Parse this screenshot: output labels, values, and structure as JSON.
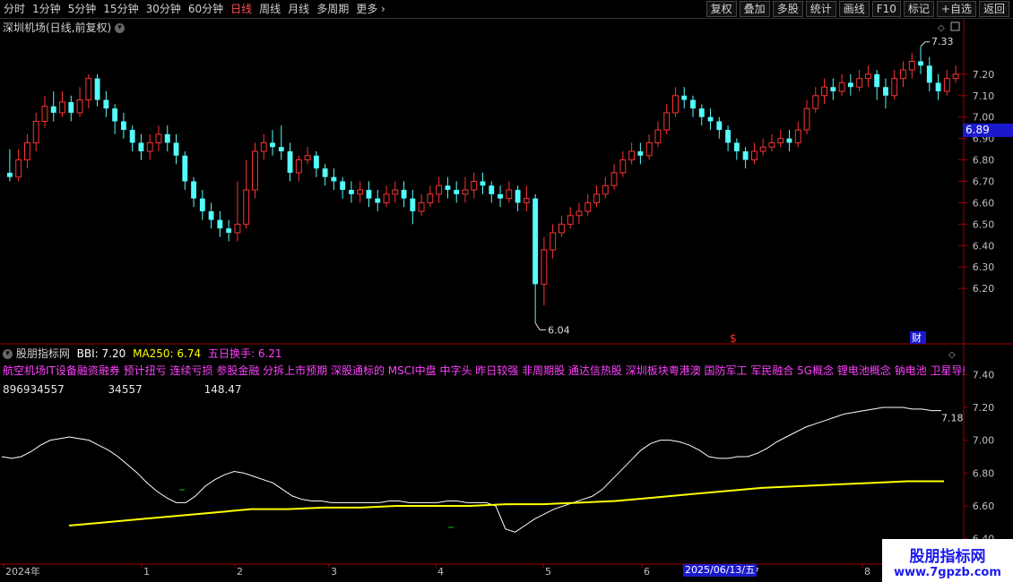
{
  "toolbar": {
    "periods": [
      "分时",
      "1分钟",
      "5分钟",
      "15分钟",
      "30分钟",
      "60分钟",
      "日线",
      "周线",
      "月线",
      "多周期",
      "更多"
    ],
    "active_period": "日线",
    "right_buttons": [
      "复权",
      "叠加",
      "多股",
      "统计",
      "画线",
      "F10",
      "标记",
      "+自选",
      "返回"
    ]
  },
  "main_chart": {
    "title": "深圳机场(日线,前复权)",
    "current_price_tag": "6.89",
    "high_label": "7.33",
    "low_label": "6.04",
    "event_markers": [
      "$",
      "财"
    ],
    "y_ticks": [
      "7.20",
      "7.10",
      "7.00",
      "6.90",
      "6.80",
      "6.70",
      "6.60",
      "6.50",
      "6.40",
      "6.30",
      "6.20"
    ]
  },
  "indicator": {
    "name": "股朋指标网",
    "bbi_label": "BBI: 7.20",
    "ma_label": "MA250: 6.74",
    "turnover_label": "五日换手: 6.21",
    "concepts": "航空机场IT设备融资融券 预计扭亏 连续亏损 参股金融 分拆上市预期 深股通标的 MSCI中盘 中字头 昨日较强 非周期股 通达信热股 深圳板块粤港澳 国防军工 军民融合 5G概念 锂电池概念 钠电池 卫星导航 百",
    "values": [
      "896934557",
      "34557",
      "148.47"
    ],
    "last_value_label": "7.18",
    "y_ticks": [
      "7.40",
      "7.20",
      "7.00",
      "6.80",
      "6.60",
      "6.40"
    ]
  },
  "x_axis": {
    "labels": [
      "2024年",
      "1",
      "2",
      "3",
      "4",
      "5",
      "6",
      "7",
      "8"
    ],
    "highlight_date": "2025/06/13/五"
  },
  "watermark": {
    "line1": "股朋指标网",
    "line2": "www.7gpzb.com"
  },
  "colors": {
    "up": "#ff3232",
    "down": "#54fcfc",
    "bbi": "#ffffff",
    "ma250": "#ffff00",
    "axis": "#a00000"
  },
  "chart_data": {
    "type": "candlestick",
    "price_ylim": [
      6.0,
      7.4
    ],
    "candles": [
      [
        6.74,
        6.72,
        6.85,
        6.7
      ],
      [
        6.72,
        6.8,
        6.85,
        6.7
      ],
      [
        6.8,
        6.88,
        6.92,
        6.76
      ],
      [
        6.88,
        6.98,
        7.02,
        6.84
      ],
      [
        6.98,
        7.05,
        7.1,
        6.95
      ],
      [
        7.05,
        7.02,
        7.12,
        6.98
      ],
      [
        7.02,
        7.07,
        7.12,
        7.0
      ],
      [
        7.07,
        7.02,
        7.1,
        6.98
      ],
      [
        7.02,
        7.08,
        7.14,
        7.0
      ],
      [
        7.08,
        7.18,
        7.2,
        7.04
      ],
      [
        7.18,
        7.08,
        7.2,
        7.05
      ],
      [
        7.08,
        7.04,
        7.12,
        7.0
      ],
      [
        7.04,
        6.98,
        7.06,
        6.92
      ],
      [
        6.98,
        6.94,
        7.02,
        6.9
      ],
      [
        6.94,
        6.88,
        6.96,
        6.84
      ],
      [
        6.88,
        6.84,
        6.92,
        6.8
      ],
      [
        6.84,
        6.88,
        6.92,
        6.8
      ],
      [
        6.88,
        6.92,
        6.96,
        6.84
      ],
      [
        6.92,
        6.88,
        6.96,
        6.84
      ],
      [
        6.88,
        6.82,
        6.92,
        6.78
      ],
      [
        6.82,
        6.7,
        6.84,
        6.66
      ],
      [
        6.7,
        6.62,
        6.72,
        6.58
      ],
      [
        6.62,
        6.56,
        6.66,
        6.52
      ],
      [
        6.56,
        6.52,
        6.6,
        6.48
      ],
      [
        6.52,
        6.48,
        6.56,
        6.44
      ],
      [
        6.48,
        6.46,
        6.52,
        6.42
      ],
      [
        6.46,
        6.5,
        6.7,
        6.42
      ],
      [
        6.5,
        6.66,
        6.8,
        6.48
      ],
      [
        6.66,
        6.84,
        6.88,
        6.62
      ],
      [
        6.84,
        6.88,
        6.92,
        6.8
      ],
      [
        6.88,
        6.86,
        6.94,
        6.82
      ],
      [
        6.86,
        6.84,
        6.96,
        6.8
      ],
      [
        6.84,
        6.74,
        6.88,
        6.7
      ],
      [
        6.74,
        6.8,
        6.82,
        6.7
      ],
      [
        6.8,
        6.82,
        6.86,
        6.78
      ],
      [
        6.82,
        6.76,
        6.84,
        6.72
      ],
      [
        6.76,
        6.72,
        6.78,
        6.68
      ],
      [
        6.72,
        6.7,
        6.76,
        6.66
      ],
      [
        6.7,
        6.66,
        6.72,
        6.62
      ],
      [
        6.66,
        6.64,
        6.7,
        6.6
      ],
      [
        6.64,
        6.66,
        6.7,
        6.6
      ],
      [
        6.66,
        6.62,
        6.7,
        6.58
      ],
      [
        6.62,
        6.6,
        6.66,
        6.56
      ],
      [
        6.6,
        6.64,
        6.68,
        6.58
      ],
      [
        6.64,
        6.66,
        6.7,
        6.6
      ],
      [
        6.66,
        6.62,
        6.7,
        6.58
      ],
      [
        6.62,
        6.56,
        6.66,
        6.5
      ],
      [
        6.56,
        6.6,
        6.64,
        6.54
      ],
      [
        6.6,
        6.64,
        6.68,
        6.58
      ],
      [
        6.64,
        6.68,
        6.72,
        6.6
      ],
      [
        6.68,
        6.66,
        6.72,
        6.62
      ],
      [
        6.66,
        6.64,
        6.7,
        6.6
      ],
      [
        6.64,
        6.66,
        6.72,
        6.6
      ],
      [
        6.66,
        6.7,
        6.74,
        6.62
      ],
      [
        6.7,
        6.68,
        6.74,
        6.64
      ],
      [
        6.68,
        6.64,
        6.7,
        6.6
      ],
      [
        6.64,
        6.62,
        6.68,
        6.58
      ],
      [
        6.62,
        6.66,
        6.7,
        6.6
      ],
      [
        6.66,
        6.6,
        6.68,
        6.56
      ],
      [
        6.6,
        6.62,
        6.68,
        6.56
      ],
      [
        6.62,
        6.22,
        6.64,
        6.04
      ],
      [
        6.22,
        6.38,
        6.44,
        6.12
      ],
      [
        6.38,
        6.46,
        6.5,
        6.34
      ],
      [
        6.46,
        6.5,
        6.54,
        6.44
      ],
      [
        6.5,
        6.54,
        6.58,
        6.48
      ],
      [
        6.54,
        6.56,
        6.6,
        6.5
      ],
      [
        6.56,
        6.6,
        6.64,
        6.54
      ],
      [
        6.6,
        6.64,
        6.68,
        6.58
      ],
      [
        6.64,
        6.68,
        6.72,
        6.62
      ],
      [
        6.68,
        6.74,
        6.78,
        6.66
      ],
      [
        6.74,
        6.8,
        6.84,
        6.72
      ],
      [
        6.8,
        6.84,
        6.88,
        6.78
      ],
      [
        6.84,
        6.82,
        6.88,
        6.78
      ],
      [
        6.82,
        6.88,
        6.92,
        6.8
      ],
      [
        6.88,
        6.94,
        6.98,
        6.86
      ],
      [
        6.94,
        7.02,
        7.06,
        6.92
      ],
      [
        7.02,
        7.1,
        7.14,
        7.0
      ],
      [
        7.1,
        7.08,
        7.14,
        7.04
      ],
      [
        7.08,
        7.04,
        7.1,
        7.0
      ],
      [
        7.04,
        7.0,
        7.06,
        6.96
      ],
      [
        7.0,
        6.98,
        7.04,
        6.94
      ],
      [
        6.98,
        6.94,
        7.0,
        6.9
      ],
      [
        6.94,
        6.88,
        6.96,
        6.84
      ],
      [
        6.88,
        6.84,
        6.9,
        6.8
      ],
      [
        6.84,
        6.8,
        6.86,
        6.76
      ],
      [
        6.8,
        6.84,
        6.88,
        6.78
      ],
      [
        6.84,
        6.86,
        6.9,
        6.82
      ],
      [
        6.86,
        6.88,
        6.92,
        6.84
      ],
      [
        6.88,
        6.9,
        6.94,
        6.86
      ],
      [
        6.9,
        6.88,
        6.94,
        6.84
      ],
      [
        6.88,
        6.94,
        6.98,
        6.86
      ],
      [
        6.94,
        7.04,
        7.08,
        6.92
      ],
      [
        7.04,
        7.1,
        7.14,
        7.02
      ],
      [
        7.1,
        7.14,
        7.18,
        7.06
      ],
      [
        7.14,
        7.12,
        7.18,
        7.08
      ],
      [
        7.12,
        7.16,
        7.2,
        7.1
      ],
      [
        7.16,
        7.14,
        7.2,
        7.1
      ],
      [
        7.14,
        7.18,
        7.22,
        7.12
      ],
      [
        7.18,
        7.2,
        7.24,
        7.14
      ],
      [
        7.2,
        7.14,
        7.22,
        7.08
      ],
      [
        7.14,
        7.1,
        7.18,
        7.04
      ],
      [
        7.1,
        7.18,
        7.22,
        7.08
      ],
      [
        7.18,
        7.22,
        7.26,
        7.14
      ],
      [
        7.22,
        7.26,
        7.3,
        7.18
      ],
      [
        7.26,
        7.24,
        7.33,
        7.2
      ],
      [
        7.24,
        7.16,
        7.28,
        7.12
      ],
      [
        7.16,
        7.12,
        7.2,
        7.08
      ],
      [
        7.12,
        7.18,
        7.22,
        7.1
      ],
      [
        7.18,
        7.2,
        7.24,
        7.16
      ]
    ],
    "indicator_ylim": [
      6.3,
      7.5
    ],
    "bbi": [
      6.9,
      6.89,
      6.9,
      6.93,
      6.97,
      7.0,
      7.01,
      7.02,
      7.01,
      7.0,
      6.97,
      6.94,
      6.9,
      6.85,
      6.8,
      6.74,
      6.69,
      6.65,
      6.62,
      6.62,
      6.66,
      6.72,
      6.76,
      6.79,
      6.81,
      6.8,
      6.78,
      6.76,
      6.74,
      6.7,
      6.66,
      6.64,
      6.63,
      6.63,
      6.62,
      6.62,
      6.62,
      6.62,
      6.62,
      6.62,
      6.63,
      6.63,
      6.62,
      6.62,
      6.62,
      6.62,
      6.63,
      6.63,
      6.62,
      6.62,
      6.62,
      6.6,
      6.46,
      6.44,
      6.48,
      6.52,
      6.55,
      6.58,
      6.6,
      6.62,
      6.64,
      6.66,
      6.7,
      6.76,
      6.82,
      6.88,
      6.94,
      6.98,
      7.0,
      7.0,
      6.99,
      6.97,
      6.94,
      6.9,
      6.89,
      6.89,
      6.9,
      6.9,
      6.92,
      6.95,
      6.99,
      7.02,
      7.05,
      7.08,
      7.1,
      7.12,
      7.14,
      7.16,
      7.17,
      7.18,
      7.19,
      7.2,
      7.2,
      7.2,
      7.19,
      7.19,
      7.18,
      7.18
    ],
    "ma250": [
      6.48,
      6.5,
      6.52,
      6.54,
      6.56,
      6.58,
      6.58,
      6.59,
      6.59,
      6.6,
      6.6,
      6.6,
      6.61,
      6.61,
      6.62,
      6.63,
      6.65,
      6.67,
      6.69,
      6.71,
      6.72,
      6.73,
      6.74,
      6.75,
      6.75
    ]
  }
}
